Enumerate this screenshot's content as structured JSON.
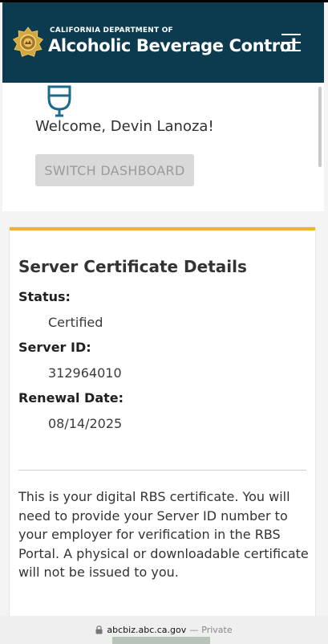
{
  "header": {
    "dept_small": "CALIFORNIA DEPARTMENT OF",
    "dept_name": "Alcoholic Beverage Control",
    "bg_color": "#0c3a4f",
    "menu_icon": "hamburger-menu-icon"
  },
  "welcome": {
    "icon": "wine-glass-icon",
    "text": "Welcome, Devin Lanoza!",
    "switch_label": "SWITCH DASHBOARD"
  },
  "card": {
    "accent_color": "#f0b429",
    "title": "Server Certificate Details",
    "status_label": "Status:",
    "status_value": "Certified",
    "server_id_label": "Server ID:",
    "server_id_value": "312964010",
    "renewal_label": "Renewal Date:",
    "renewal_value": "08/14/2025",
    "description": "This is your digital RBS certificate. You will need to provide your Server ID number to your employer for verification in the RBS Portal. A physical or downloadable certificate will not be issued to you."
  },
  "browser": {
    "lock_icon": "lock-icon",
    "url": "abcbiz.abc.ca.gov",
    "separator": "—",
    "mode": "Private"
  }
}
